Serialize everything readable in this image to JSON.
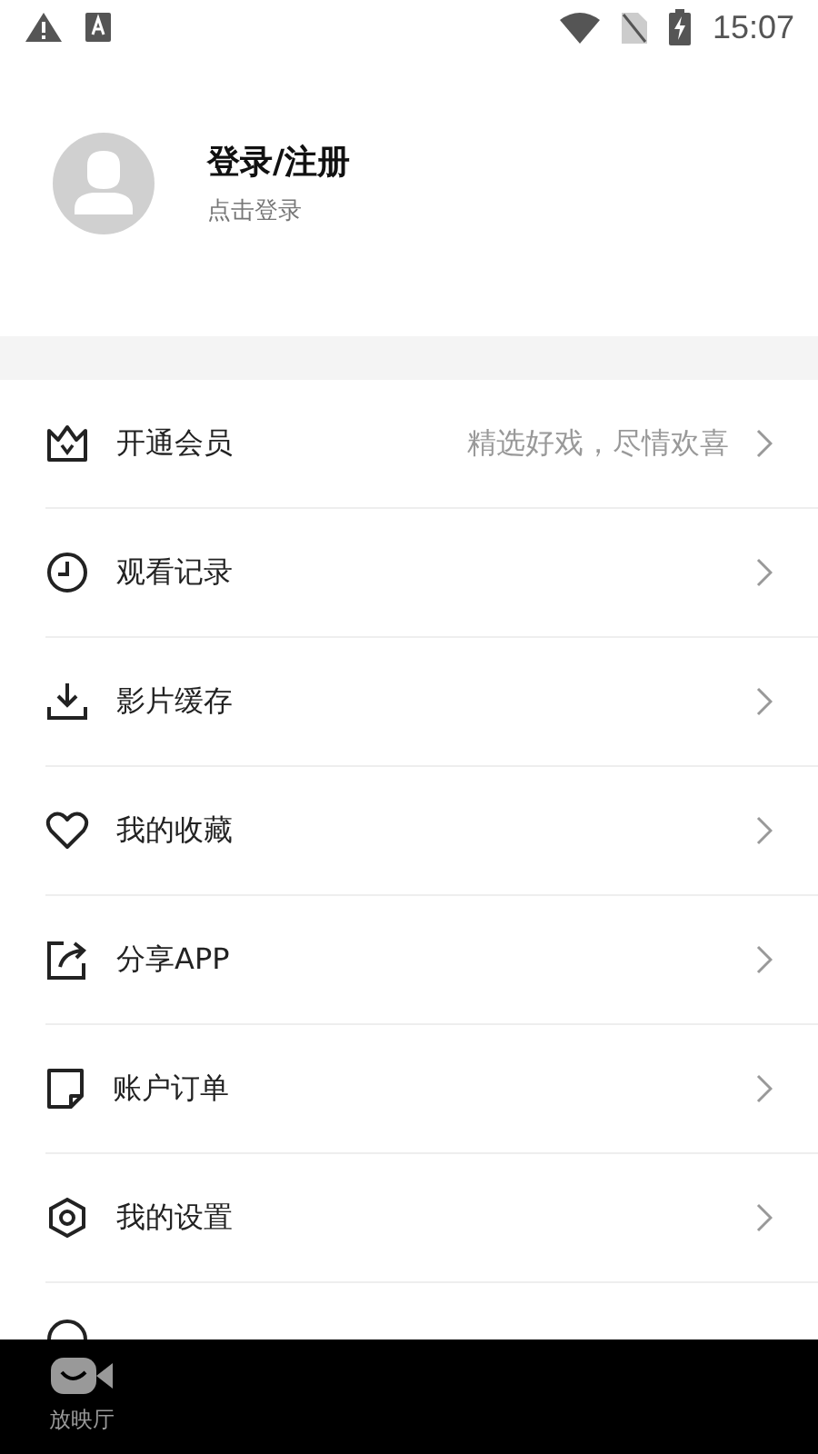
{
  "status_bar": {
    "time": "15:07"
  },
  "profile": {
    "title": "登录/注册",
    "subtitle": "点击登录"
  },
  "menu": [
    {
      "label": "开通会员",
      "hint": "精选好戏，尽情欢喜"
    },
    {
      "label": "观看记录"
    },
    {
      "label": "影片缓存"
    },
    {
      "label": "我的收藏"
    },
    {
      "label": "分享APP"
    },
    {
      "label": "账户订单"
    },
    {
      "label": "我的设置"
    }
  ],
  "bottom_nav": [
    {
      "label": "放映厅"
    }
  ]
}
